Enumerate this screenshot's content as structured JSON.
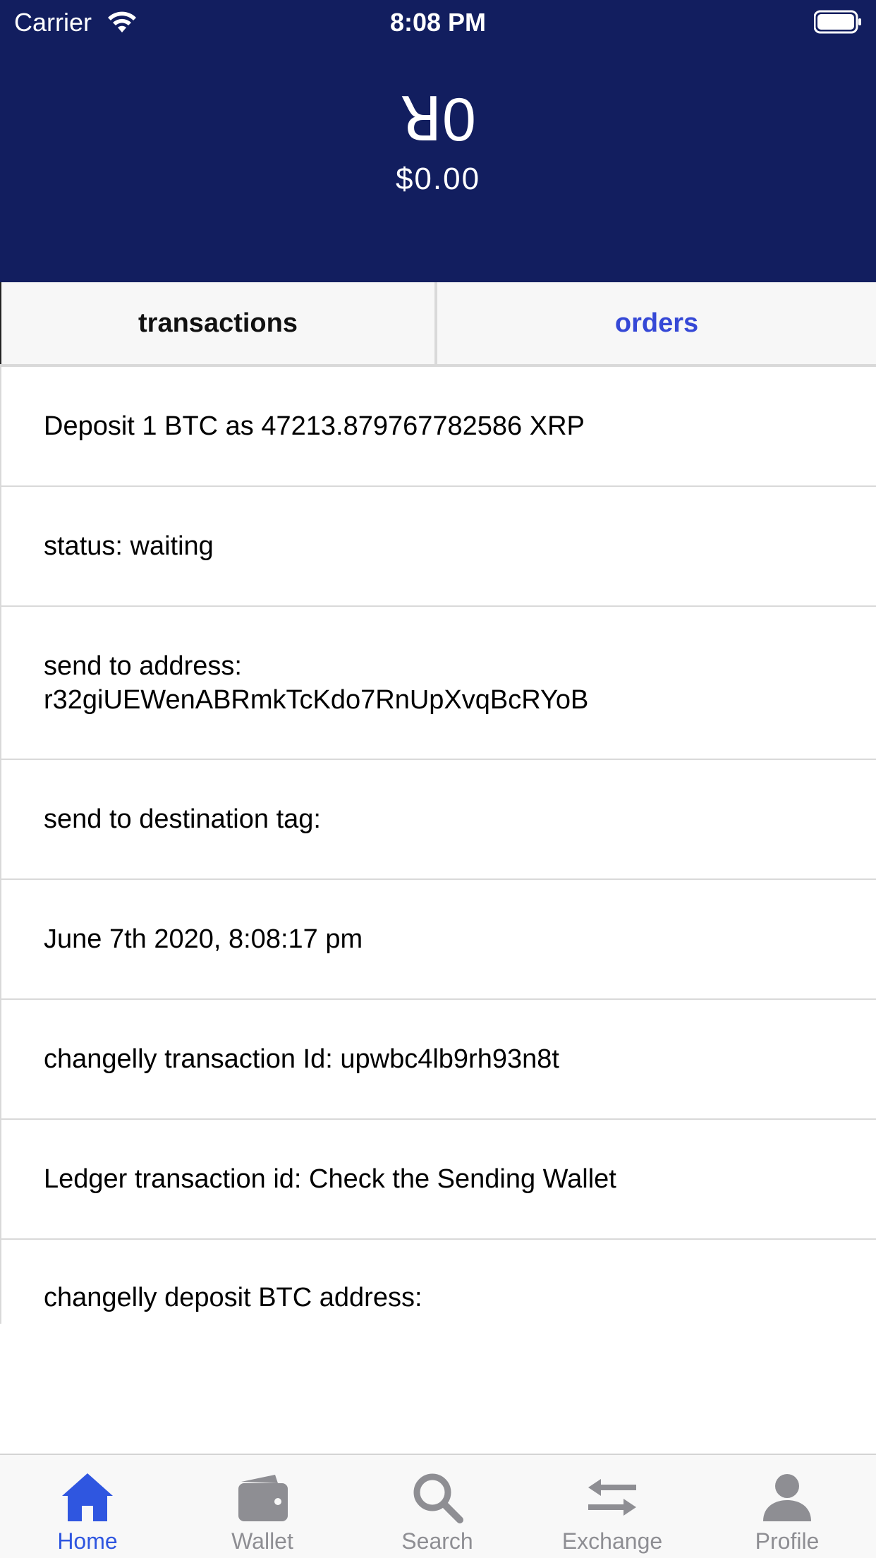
{
  "status_bar": {
    "carrier": "Carrier",
    "time": "8:08 PM"
  },
  "header": {
    "balance_xrp": "ꓤ0",
    "balance_usd": "$0.00",
    "background_color": "#121e5f"
  },
  "tabs": [
    {
      "label": "transactions",
      "selected": false
    },
    {
      "label": "orders",
      "selected": true
    }
  ],
  "order_details": [
    {
      "text": "Deposit 1 BTC as 47213.879767782586 XRP"
    },
    {
      "text": "status:  waiting"
    },
    {
      "line1": "send to address:",
      "line2": "r32giUEWenABRmkTcKdo7RnUpXvqBcRYoB"
    },
    {
      "text": "send to destination tag:"
    },
    {
      "text": "June 7th 2020, 8:08:17 pm"
    },
    {
      "text": "changelly transaction Id:  upwbc4lb9rh93n8t"
    },
    {
      "text": "Ledger transaction id: Check the Sending Wallet"
    },
    {
      "text": "changelly deposit BTC address:"
    }
  ],
  "tab_bar": {
    "items": [
      {
        "label": "Home",
        "icon": "home-icon",
        "active": true
      },
      {
        "label": "Wallet",
        "icon": "wallet-icon",
        "active": false
      },
      {
        "label": "Search",
        "icon": "search-icon",
        "active": false
      },
      {
        "label": "Exchange",
        "icon": "exchange-icon",
        "active": false
      },
      {
        "label": "Profile",
        "icon": "profile-icon",
        "active": false
      }
    ],
    "active_color": "#2f56e0",
    "inactive_color": "#8e8e93"
  }
}
